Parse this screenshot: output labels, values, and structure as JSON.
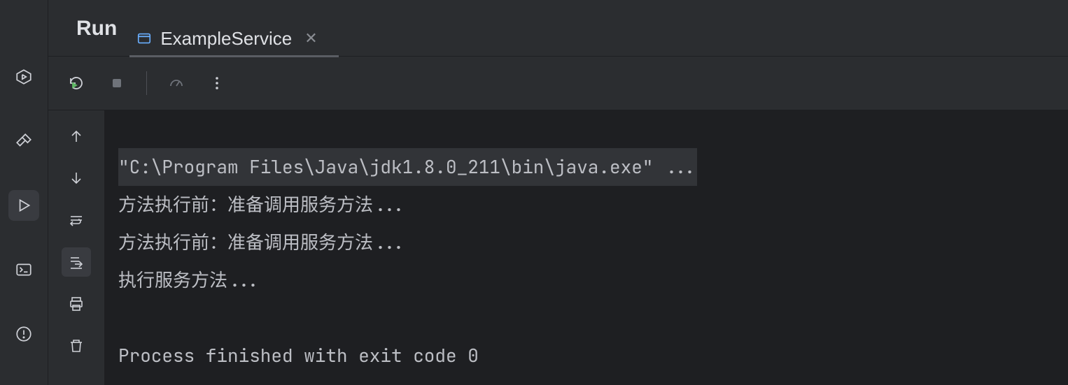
{
  "header": {
    "tool_window_title": "Run",
    "tabs": [
      {
        "icon": "app-window-icon",
        "label": "ExampleService",
        "active": true
      }
    ]
  },
  "toolbar": {
    "rerun": "rerun-icon",
    "stop": "stop-icon",
    "performance": "gauge-icon",
    "more": "more-vertical-icon"
  },
  "leftbar": {
    "items": [
      "services-icon",
      "build-icon",
      "run-icon",
      "terminal-icon",
      "problems-icon"
    ],
    "selected_index": 2
  },
  "gutter": {
    "items": [
      "up-arrow-icon",
      "down-arrow-icon",
      "soft-wrap-icon",
      "scroll-to-end-icon",
      "print-icon",
      "trash-icon"
    ],
    "active_index": 3
  },
  "console": {
    "lines": [
      {
        "text": "\"C:\\Program Files\\Java\\jdk1.8.0_211\\bin\\java.exe\" ...",
        "highlight": true
      },
      {
        "text": "方法执行前：准备调用服务方法..."
      },
      {
        "text": "方法执行前：准备调用服务方法..."
      },
      {
        "text": "执行服务方法..."
      },
      {
        "text": ""
      },
      {
        "text": "Process finished with exit code 0"
      }
    ]
  }
}
